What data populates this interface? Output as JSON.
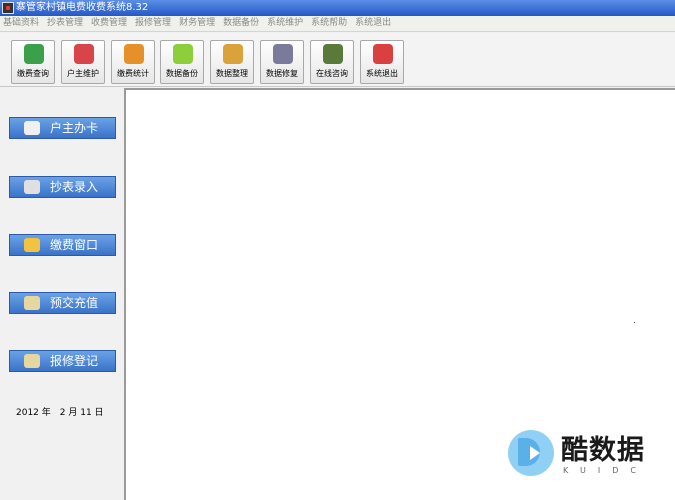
{
  "titlebar": {
    "title": "寨管家村镇电费收费系统8.32"
  },
  "menu": [
    "基础资料",
    "抄表管理",
    "收费管理",
    "报修管理",
    "财务管理",
    "数据备份",
    "系统维护",
    "系统帮助",
    "系统退出"
  ],
  "toolbar": [
    {
      "label": "缴费查询",
      "icon": "magnifier-icon",
      "color": "#3aa04a"
    },
    {
      "label": "户主维护",
      "icon": "users-icon",
      "color": "#d9434a"
    },
    {
      "label": "缴费统计",
      "icon": "basket-icon",
      "color": "#e6902a"
    },
    {
      "label": "数据备份",
      "icon": "backup-icon",
      "color": "#8ccf3a"
    },
    {
      "label": "数据整理",
      "icon": "palette-icon",
      "color": "#d9a23a"
    },
    {
      "label": "数据修复",
      "icon": "disk-icon",
      "color": "#7a7a9a"
    },
    {
      "label": "在线咨询",
      "icon": "help-icon",
      "color": "#5a7a3a"
    },
    {
      "label": "系统退出",
      "icon": "power-icon",
      "color": "#d94040"
    }
  ],
  "sidebar": [
    {
      "label": "户主办卡",
      "icon": "person-icon",
      "color": "#f0f0f0"
    },
    {
      "label": "抄表录入",
      "icon": "meter-icon",
      "color": "#e0e0e0"
    },
    {
      "label": "缴费窗口",
      "icon": "coins-icon",
      "color": "#f2c340"
    },
    {
      "label": "预交充值",
      "icon": "card-icon",
      "color": "#e6d7a0"
    },
    {
      "label": "报修登记",
      "icon": "notebook-icon",
      "color": "#e6d7a0"
    }
  ],
  "date": "2012 年　2 月 11 日",
  "watermark": {
    "text": "酷数据",
    "sub": "KUIDC"
  }
}
